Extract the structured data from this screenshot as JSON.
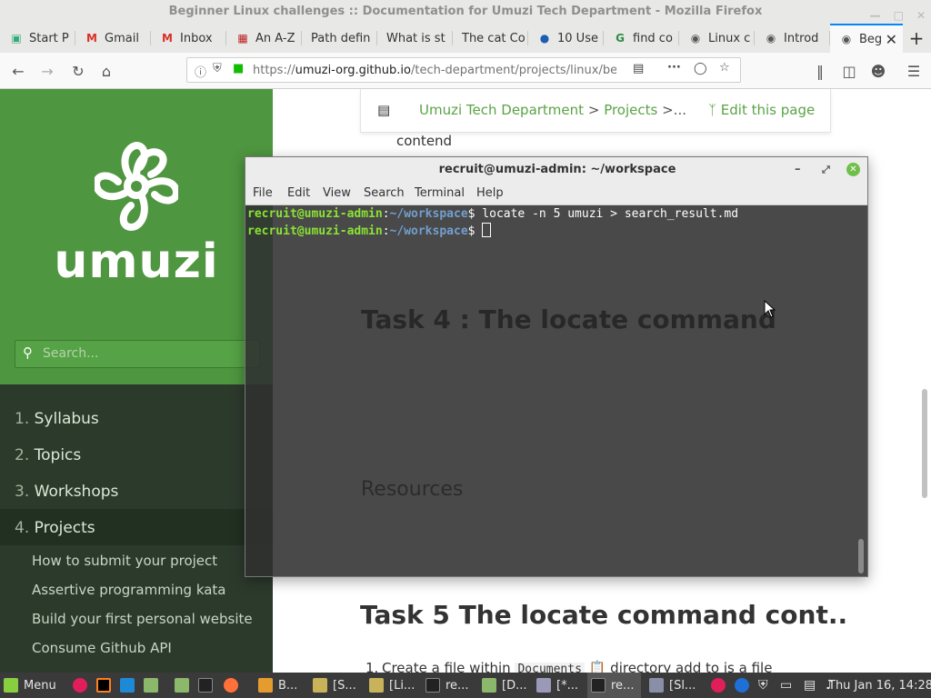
{
  "window": {
    "title": "Beginner Linux challenges :: Documentation for Umuzi Tech Department - Mozilla Firefox"
  },
  "tabs": [
    {
      "label": "Start P",
      "icon": "globe-icon"
    },
    {
      "label": "Gmail",
      "icon": "gmail-icon"
    },
    {
      "label": "Inbox",
      "icon": "gmail-icon"
    },
    {
      "label": "An A-Z",
      "icon": "book-icon"
    },
    {
      "label": "Path defin",
      "icon": "page-icon"
    },
    {
      "label": "What is st",
      "icon": "page-icon"
    },
    {
      "label": "The cat Co",
      "icon": "page-icon"
    },
    {
      "label": "10 Use",
      "icon": "page-icon"
    },
    {
      "label": "find co",
      "icon": "geeks-icon"
    },
    {
      "label": "Linux c",
      "icon": "page-icon"
    },
    {
      "label": "Introd",
      "icon": "page-icon"
    },
    {
      "label": "Beg",
      "icon": "page-icon",
      "active": true
    }
  ],
  "url": {
    "scheme": "https://",
    "host": "umuzi-org.github.io",
    "path": "/tech-department/projects/linux/beg"
  },
  "sidebar": {
    "brand": "umuzi",
    "search_placeholder": "Search...",
    "nav": [
      {
        "num": "1.",
        "label": "Syllabus"
      },
      {
        "num": "2.",
        "label": "Topics"
      },
      {
        "num": "3.",
        "label": "Workshops"
      },
      {
        "num": "4.",
        "label": "Projects"
      }
    ],
    "subitems": [
      "How to submit your project",
      "Assertive programming kata",
      "Build your first personal website",
      "Consume Github API"
    ]
  },
  "content": {
    "breadcrumb": {
      "root": "Umuzi Tech Department",
      "sep": ">",
      "item": "Projects",
      "more": ">...",
      "edit": "Edit this page"
    },
    "text_contend": "contend",
    "ghost_heading": "Task 4 : The locate command",
    "ghost_resources": "Resources",
    "heading_task5": "Task 5 The locate command cont..",
    "task5_item": {
      "num": "1.",
      "before": "Create a file within",
      "code": "Documents",
      "after": "directory add to is a file"
    }
  },
  "terminal": {
    "title": "recruit@umuzi-admin: ~/workspace",
    "menu": [
      "File",
      "Edit",
      "View",
      "Search",
      "Terminal",
      "Help"
    ],
    "lines": [
      {
        "user": "recruit@umuzi-admin",
        "path": "~/workspace",
        "cmd": "locate -n 5 umuzi > search_result.md"
      },
      {
        "user": "recruit@umuzi-admin",
        "path": "~/workspace",
        "cmd": ""
      }
    ]
  },
  "taskbar": {
    "menu_label": "Menu",
    "tasks": [
      "B...",
      "[S...",
      "[Li...",
      "re...",
      "[D...",
      "[*...",
      "re...",
      "[Sl..."
    ],
    "clock": "Thu Jan 16, 14:28"
  }
}
